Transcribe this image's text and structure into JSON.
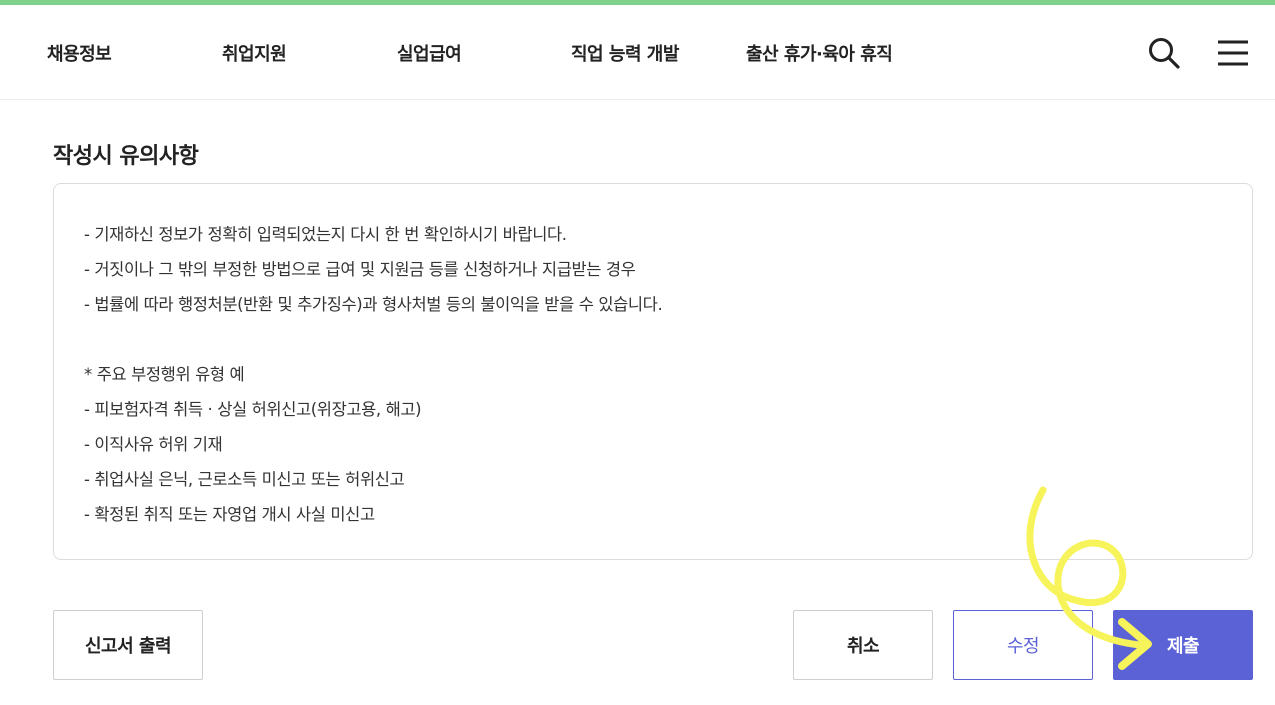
{
  "colors": {
    "accent_bar": "#7fd18c",
    "primary": "#5b62d6",
    "annotation": "#f7f35a"
  },
  "nav": {
    "items": [
      {
        "label": "채용정보"
      },
      {
        "label": "취업지원"
      },
      {
        "label": "실업급여"
      },
      {
        "label": "직업 능력 개발"
      },
      {
        "label": "출산 휴가·육아 휴직"
      }
    ],
    "search_icon": "search-icon",
    "menu_icon": "hamburger-menu-icon"
  },
  "notice": {
    "title": "작성시 유의사항",
    "lines": [
      "- 기재하신 정보가 정확히 입력되었는지 다시 한 번 확인하시기 바랍니다.",
      "- 거짓이나 그 밖의 부정한 방법으로 급여 및 지원금 등를 신청하거나 지급받는 경우",
      "- 법률에 따라 행정처분(반환 및 추가징수)과 형사처벌 등의 불이익을 받을 수 있습니다.",
      "* 주요 부정행위 유형 예",
      "- 피보험자격 취득 · 상실 허위신고(위장고용, 해고)",
      "- 이직사유 허위 기재",
      "- 취업사실 은닉, 근로소득 미신고 또는 허위신고",
      "- 확정된 취직 또는 자영업 개시 사실 미신고"
    ]
  },
  "buttons": {
    "print": "신고서 출력",
    "cancel": "취소",
    "edit": "수정",
    "submit": "제출"
  }
}
